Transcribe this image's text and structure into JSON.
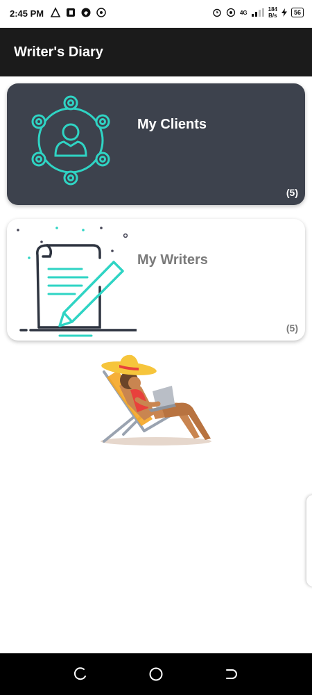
{
  "status_bar": {
    "time": "2:45 PM",
    "network_speed_top": "184",
    "network_speed_bottom": "B/s",
    "network_type": "4G",
    "battery": "56"
  },
  "app_bar": {
    "title": "Writer's Diary"
  },
  "cards": [
    {
      "title": "My Clients",
      "count": "(5)",
      "icon": "clients-network-icon"
    },
    {
      "title": "My Writers",
      "count": "(5)",
      "icon": "document-pen-icon"
    }
  ],
  "illustration": {
    "icon": "woman-beach-chair-laptop-illustration"
  },
  "nav_bar": {
    "icons": [
      "recents-icon",
      "home-icon",
      "back-icon"
    ]
  },
  "colors": {
    "app_bar": "#1b1b1b",
    "clients_card": "#3d424d",
    "accent_teal": "#2fd4c4",
    "writers_text": "#7a7a7a"
  }
}
